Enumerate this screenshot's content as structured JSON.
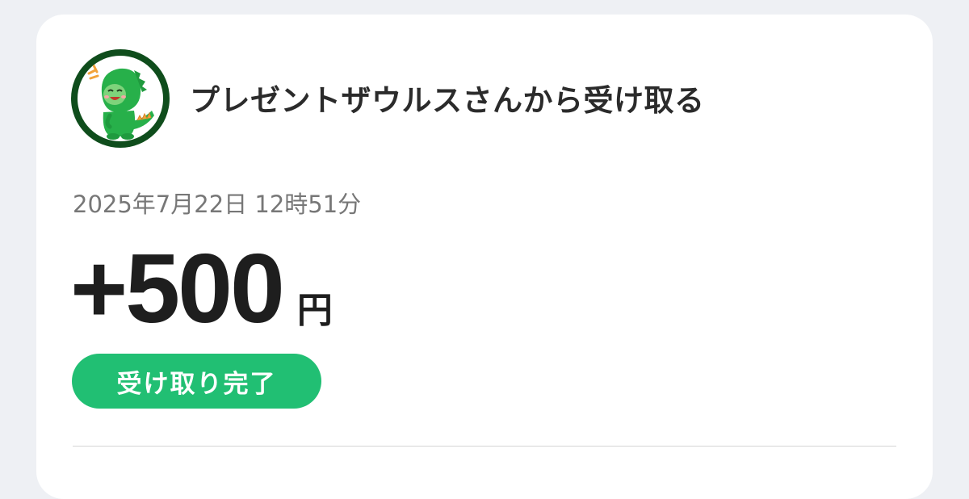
{
  "transaction": {
    "title": "プレゼントザウルスさんから受け取る",
    "datetime": "2025年7月22日 12時51分",
    "amount": "+500",
    "currency": "円",
    "status": "受け取り完了"
  },
  "avatar": {
    "icon": "dinosaur-mascot-icon",
    "ring_color": "#0f4d1c",
    "mascot_color": "#27b04a"
  },
  "colors": {
    "status_badge": "#21bf73",
    "page_background": "#eef0f4"
  }
}
